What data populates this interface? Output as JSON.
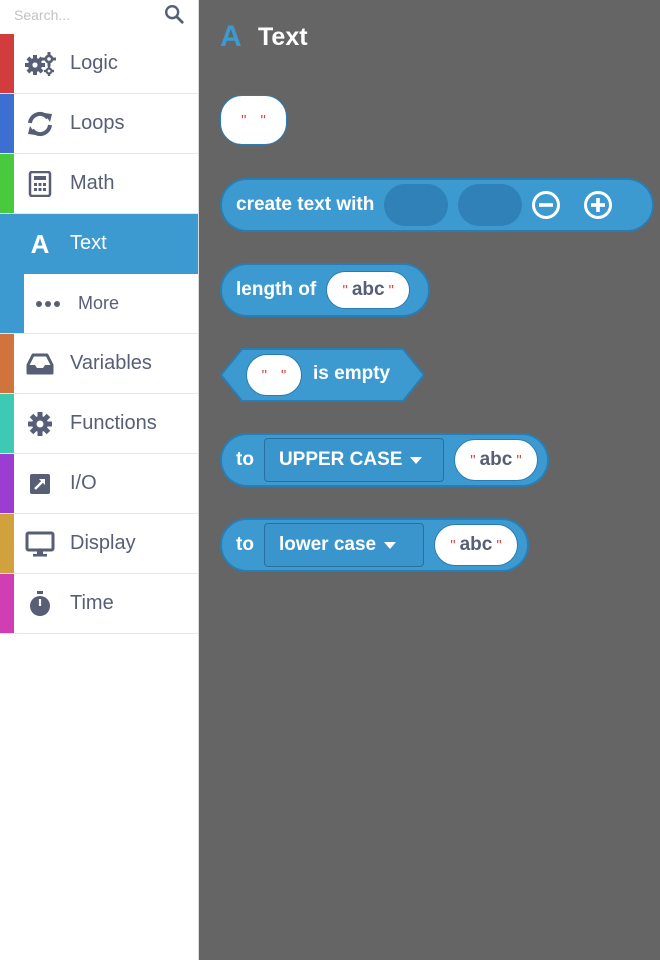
{
  "search": {
    "placeholder": "Search..."
  },
  "categories": [
    {
      "label": "Logic",
      "color": "#d13d3d",
      "icon": "gears-icon"
    },
    {
      "label": "Loops",
      "color": "#3d6fd1",
      "icon": "loop-arrows-icon"
    },
    {
      "label": "Math",
      "color": "#49c93d",
      "icon": "calculator-icon"
    },
    {
      "label": "Text",
      "color": "#3d9ad1",
      "icon": "letter-a-icon",
      "selected": true
    },
    {
      "label": "More",
      "color": "#3d9ad1",
      "icon": "ellipsis-icon",
      "sub": true
    },
    {
      "label": "Variables",
      "color": "#d1733d",
      "icon": "inbox-tray-icon"
    },
    {
      "label": "Functions",
      "color": "#3dc9b3",
      "icon": "gear-icon"
    },
    {
      "label": "I/O",
      "color": "#9b3dd1",
      "icon": "arrow-box-icon"
    },
    {
      "label": "Display",
      "color": "#d1a13d",
      "icon": "monitor-icon"
    },
    {
      "label": "Time",
      "color": "#d13db3",
      "icon": "stopwatch-icon"
    }
  ],
  "flyout": {
    "icon": "A",
    "title": "Text",
    "blocks": {
      "create_text_with": "create text with",
      "length_of": "length of",
      "is_empty": "is empty",
      "to_upper": "to",
      "to_lower": "to",
      "upper_case_option": "UPPER CASE",
      "lower_case_option": "lower case",
      "abc": "abc",
      "quote_open": "\"",
      "quote_close": "\""
    }
  },
  "colors": {
    "accent": "#3d9ad1",
    "workspace": "#656565",
    "block_border": "#2a7db3"
  }
}
